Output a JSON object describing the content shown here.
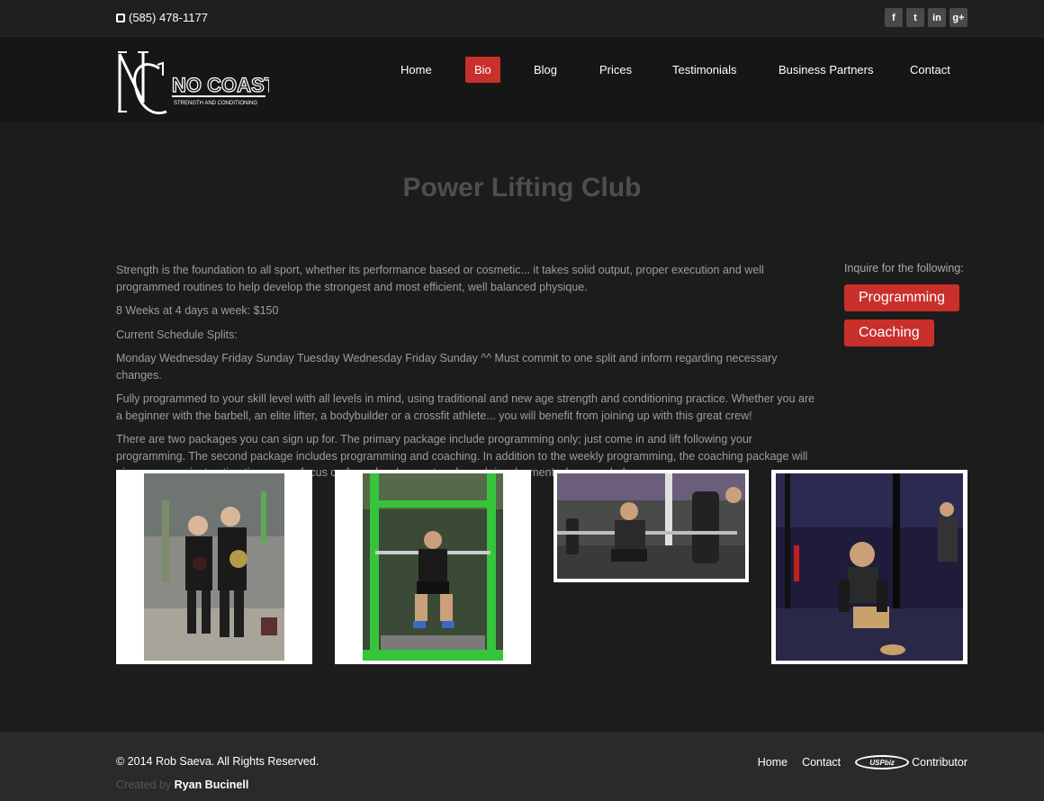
{
  "topbar": {
    "phone": "(585) 478-1177",
    "social": [
      {
        "icon": "facebook-icon",
        "glyph": "f"
      },
      {
        "icon": "twitter-icon",
        "glyph": "t"
      },
      {
        "icon": "linkedin-icon",
        "glyph": "in"
      },
      {
        "icon": "googleplus-icon",
        "glyph": "g+"
      }
    ]
  },
  "header": {
    "logo_text": "NO COAST",
    "logo_sub": "STRENGTH AND CONDITIONING",
    "nav": [
      "Home",
      "Bio",
      "Blog",
      "Prices",
      "Testimonials",
      "Business Partners",
      "Contact"
    ],
    "active": "Bio"
  },
  "page": {
    "title": "Power Lifting Club",
    "paragraphs": [
      "Strength is the foundation to all sport, whether its performance based or cosmetic... it takes solid output, proper execution and well programmed routines to help develop the strongest and most efficient, well balanced physique.",
      "8 Weeks at 4 days a week: $150",
      "Current Schedule Splits:",
      "Monday Wednesday Friday Sunday Tuesday Wednesday Friday Sunday ^^ Must commit to one split and inform regarding necessary changes.",
      "Fully programmed to your skill level with all levels in mind, using traditional and new age strength and conditioning practice. Whether you are a beginner with the barbell, an elite lifter, a bodybuilder or a crossfit athlete... you will benefit from joining up with this great crew!",
      "There are two packages you can sign up for. The primary package include programming only; just come in and lift following your programming. The second package includes programming and coaching. In addition to the weekly programming, the coaching package will give you more instruction time, more focus on form development and coach involvement when needed."
    ]
  },
  "sidebar": {
    "label": "Inquire for the following:",
    "buttons": [
      "Programming",
      "Coaching"
    ]
  },
  "footer": {
    "copyright": "© 2014 Rob Saeva. All Rights Reserved.",
    "created_by": "Created by",
    "author": "Ryan Bucinell",
    "links": [
      "Home",
      "Contact"
    ],
    "contributor": "Contributor",
    "usp_logo": "USPbiz"
  },
  "colors": {
    "accent": "#c9302c",
    "background": "#1c1c1c",
    "footer": "#2a2a2a"
  }
}
